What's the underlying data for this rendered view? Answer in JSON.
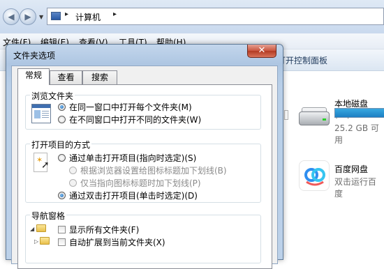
{
  "explorer": {
    "address": {
      "icon": "computer-icon",
      "separator": "▸",
      "crumb": "计算机"
    },
    "menu": [
      "文件(F)",
      "编辑(E)",
      "查看(V)",
      "工具(T)",
      "帮助(H)"
    ],
    "command_bar": {
      "control_panel": "打开控制面板"
    },
    "drive": {
      "name": "本地磁盘 (D:)",
      "free": "25.2 GB 可用",
      "used_fraction": 0.55,
      "bar_color": "#2a96d6"
    },
    "app": {
      "name": "百度网盘",
      "desc": "双击运行百度"
    }
  },
  "dialog": {
    "title": "文件夹选项",
    "close_glyph": "✕",
    "tabs": [
      "常规",
      "查看",
      "搜索"
    ],
    "active_tab": 0,
    "browse": {
      "title": "浏览文件夹",
      "options": [
        {
          "label": "在同一窗口中打开每个文件夹(M)",
          "checked": true
        },
        {
          "label": "在不同窗口中打开不同的文件夹(W)",
          "checked": false
        }
      ]
    },
    "click": {
      "title": "打开项目的方式",
      "single": "通过单击打开项目(指向时选定)(S)",
      "underline_browser": "根据浏览器设置给图标标题加下划线(B)",
      "underline_point": "仅当指向图标标题时加下划线(P)",
      "double": "通过双击打开项目(单击时选定)(D)"
    },
    "nav": {
      "title": "导航窗格",
      "show_all": "显示所有文件夹(F)",
      "auto_expand": "自动扩展到当前文件夹(X)"
    }
  }
}
